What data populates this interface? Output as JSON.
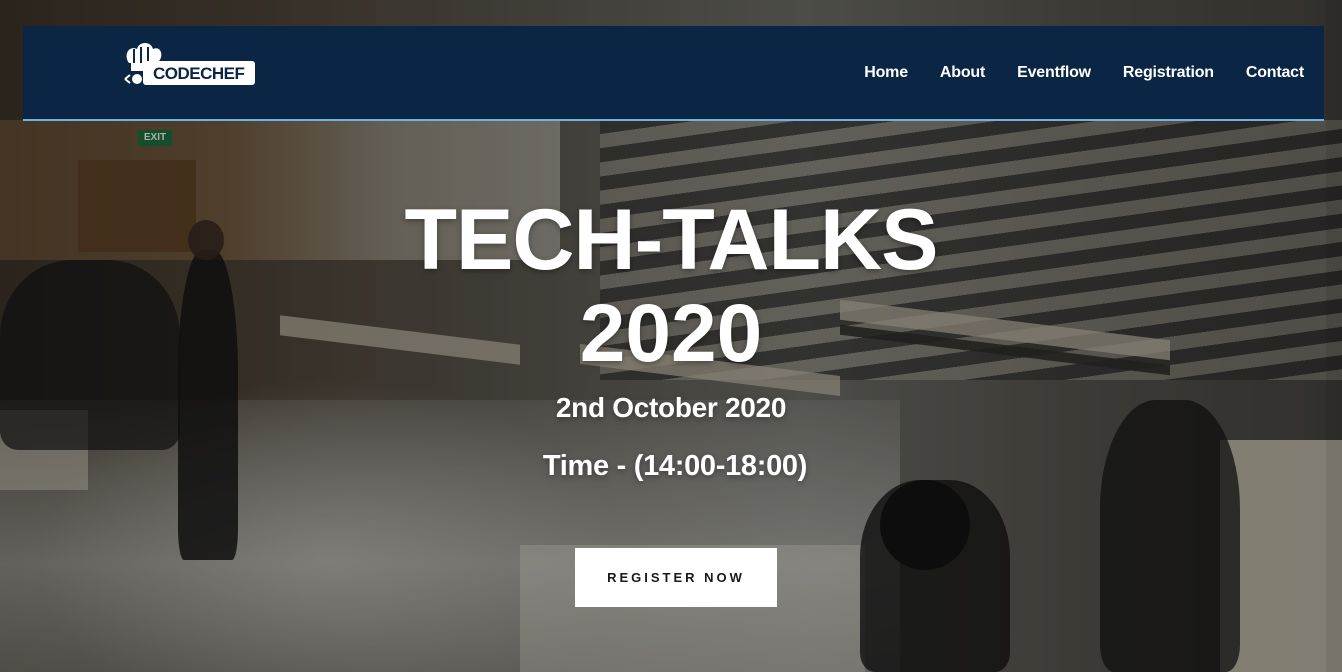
{
  "brand": {
    "logo_text": "CODECHEF"
  },
  "nav": {
    "items": [
      {
        "label": "Home"
      },
      {
        "label": "About"
      },
      {
        "label": "Eventflow"
      },
      {
        "label": "Registration"
      },
      {
        "label": "Contact"
      }
    ]
  },
  "hero": {
    "title_line1": "TECH-TALKS",
    "title_line2": "2020",
    "date": "2nd October 2020",
    "time": "Time - (14:00-18:00)",
    "cta_label": "REGISTER NOW",
    "exit_sign": "EXIT"
  },
  "colors": {
    "navbar_bg": "#0b2545",
    "navbar_border": "#6fb3e0",
    "cta_bg": "#ffffff",
    "hero_text": "#ffffff"
  }
}
